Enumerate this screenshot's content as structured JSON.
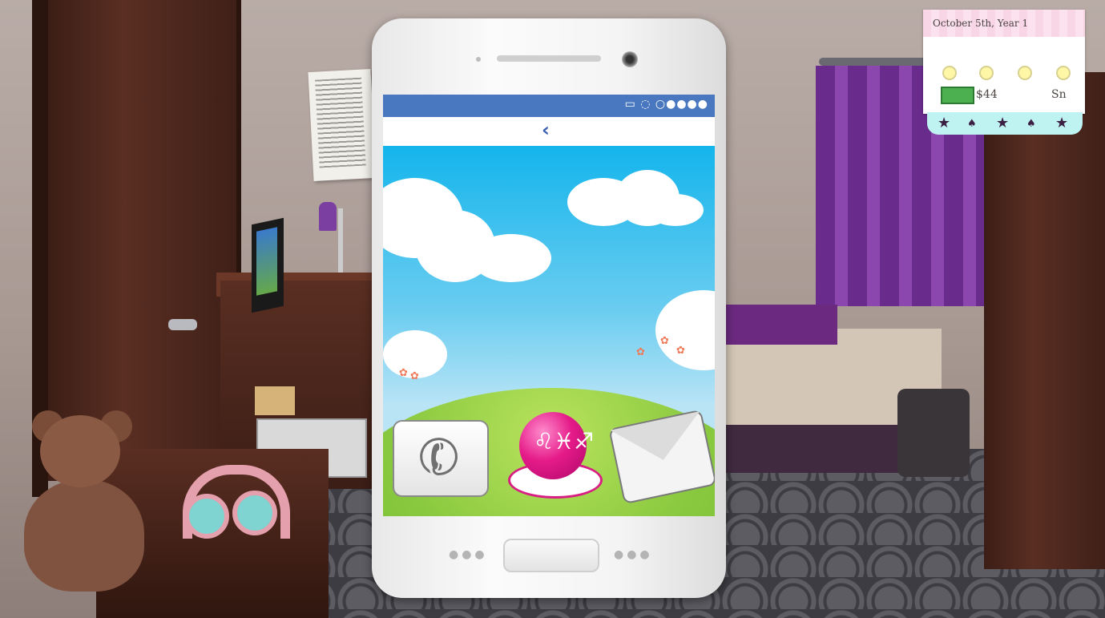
{
  "hud": {
    "date": "October 5th, Year 1",
    "money": "$44",
    "season": "Sn",
    "money_icon_label": "$"
  },
  "phone": {
    "status_icons": "▭ ◌ ○●●●●",
    "back_label": "‹",
    "apps": [
      {
        "name": "Phone",
        "icon": "phone-handset-icon"
      },
      {
        "name": "Horoscope",
        "icon": "horoscope-orb-icon",
        "glyph": "♌♓♐"
      },
      {
        "name": "Mail",
        "icon": "envelope-icon"
      }
    ]
  },
  "colors": {
    "status_bar": "#4a78c0",
    "back_arrow": "#3b5fb0",
    "horoscope_pink": "#e51b89",
    "hud_pink": "#f8d6e6",
    "hud_teal": "#bff3f2"
  }
}
